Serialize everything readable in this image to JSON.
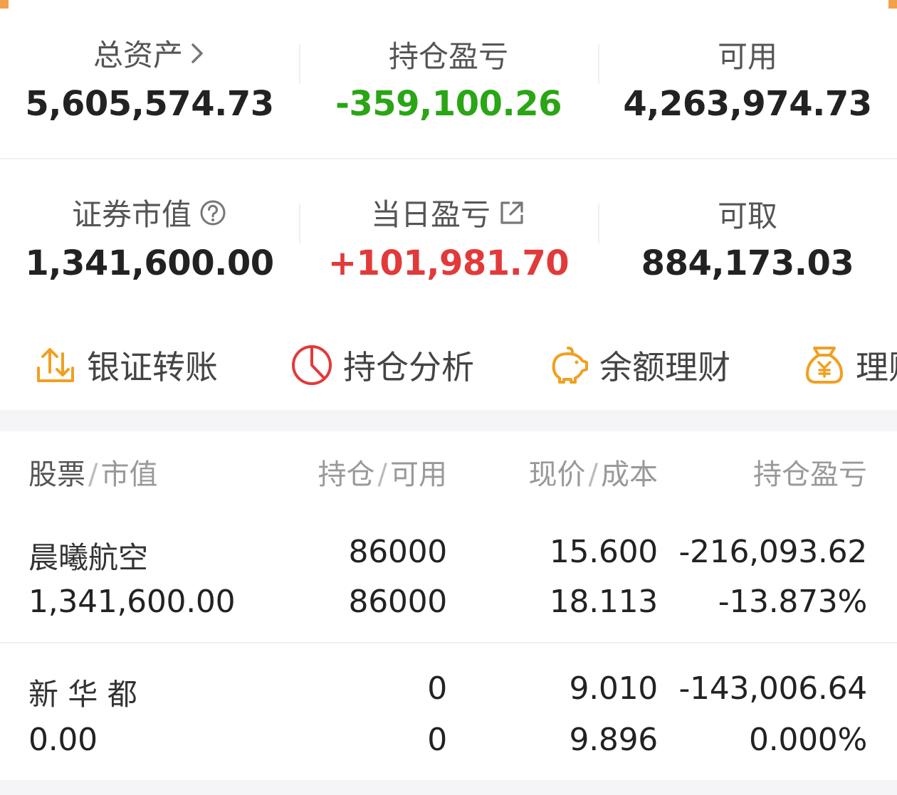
{
  "summary": {
    "total_assets": {
      "label": "总资产",
      "value": "5,605,574.73"
    },
    "position_pnl": {
      "label": "持仓盈亏",
      "value": "-359,100.26",
      "color": "#2aa515"
    },
    "available": {
      "label": "可用",
      "value": "4,263,974.73"
    },
    "market_value": {
      "label": "证券市值",
      "value": "1,341,600.00"
    },
    "daily_pnl": {
      "label": "当日盈亏",
      "value": "+101,981.70",
      "color": "#e23a3a"
    },
    "withdrawable": {
      "label": "可取",
      "value": "884,173.03"
    }
  },
  "actions": [
    {
      "label": "银证转账",
      "icon": "transfer-icon"
    },
    {
      "label": "持仓分析",
      "icon": "pie-chart-icon"
    },
    {
      "label": "余额理财",
      "icon": "piggy-bank-icon"
    },
    {
      "label": "理财",
      "icon": "money-bag-icon"
    }
  ],
  "table": {
    "headers": {
      "stock": "股票",
      "market_value": "市值",
      "position": "持仓",
      "available": "可用",
      "price": "现价",
      "cost": "成本",
      "pnl": "持仓盈亏",
      "sep": "/"
    },
    "rows": [
      {
        "name": "晨曦航空",
        "market_value": "1,341,600.00",
        "position": "86000",
        "available": "86000",
        "price": "15.600",
        "cost": "18.113",
        "pnl": "-216,093.62",
        "pnl_pct": "-13.873%"
      },
      {
        "name": "新 华 都",
        "market_value": "0.00",
        "position": "0",
        "available": "0",
        "price": "9.010",
        "cost": "9.896",
        "pnl": "-143,006.64",
        "pnl_pct": "0.000%"
      }
    ]
  },
  "colors": {
    "accent": "#f0a020",
    "loss": "#2aa515",
    "gain": "#e23a3a"
  }
}
